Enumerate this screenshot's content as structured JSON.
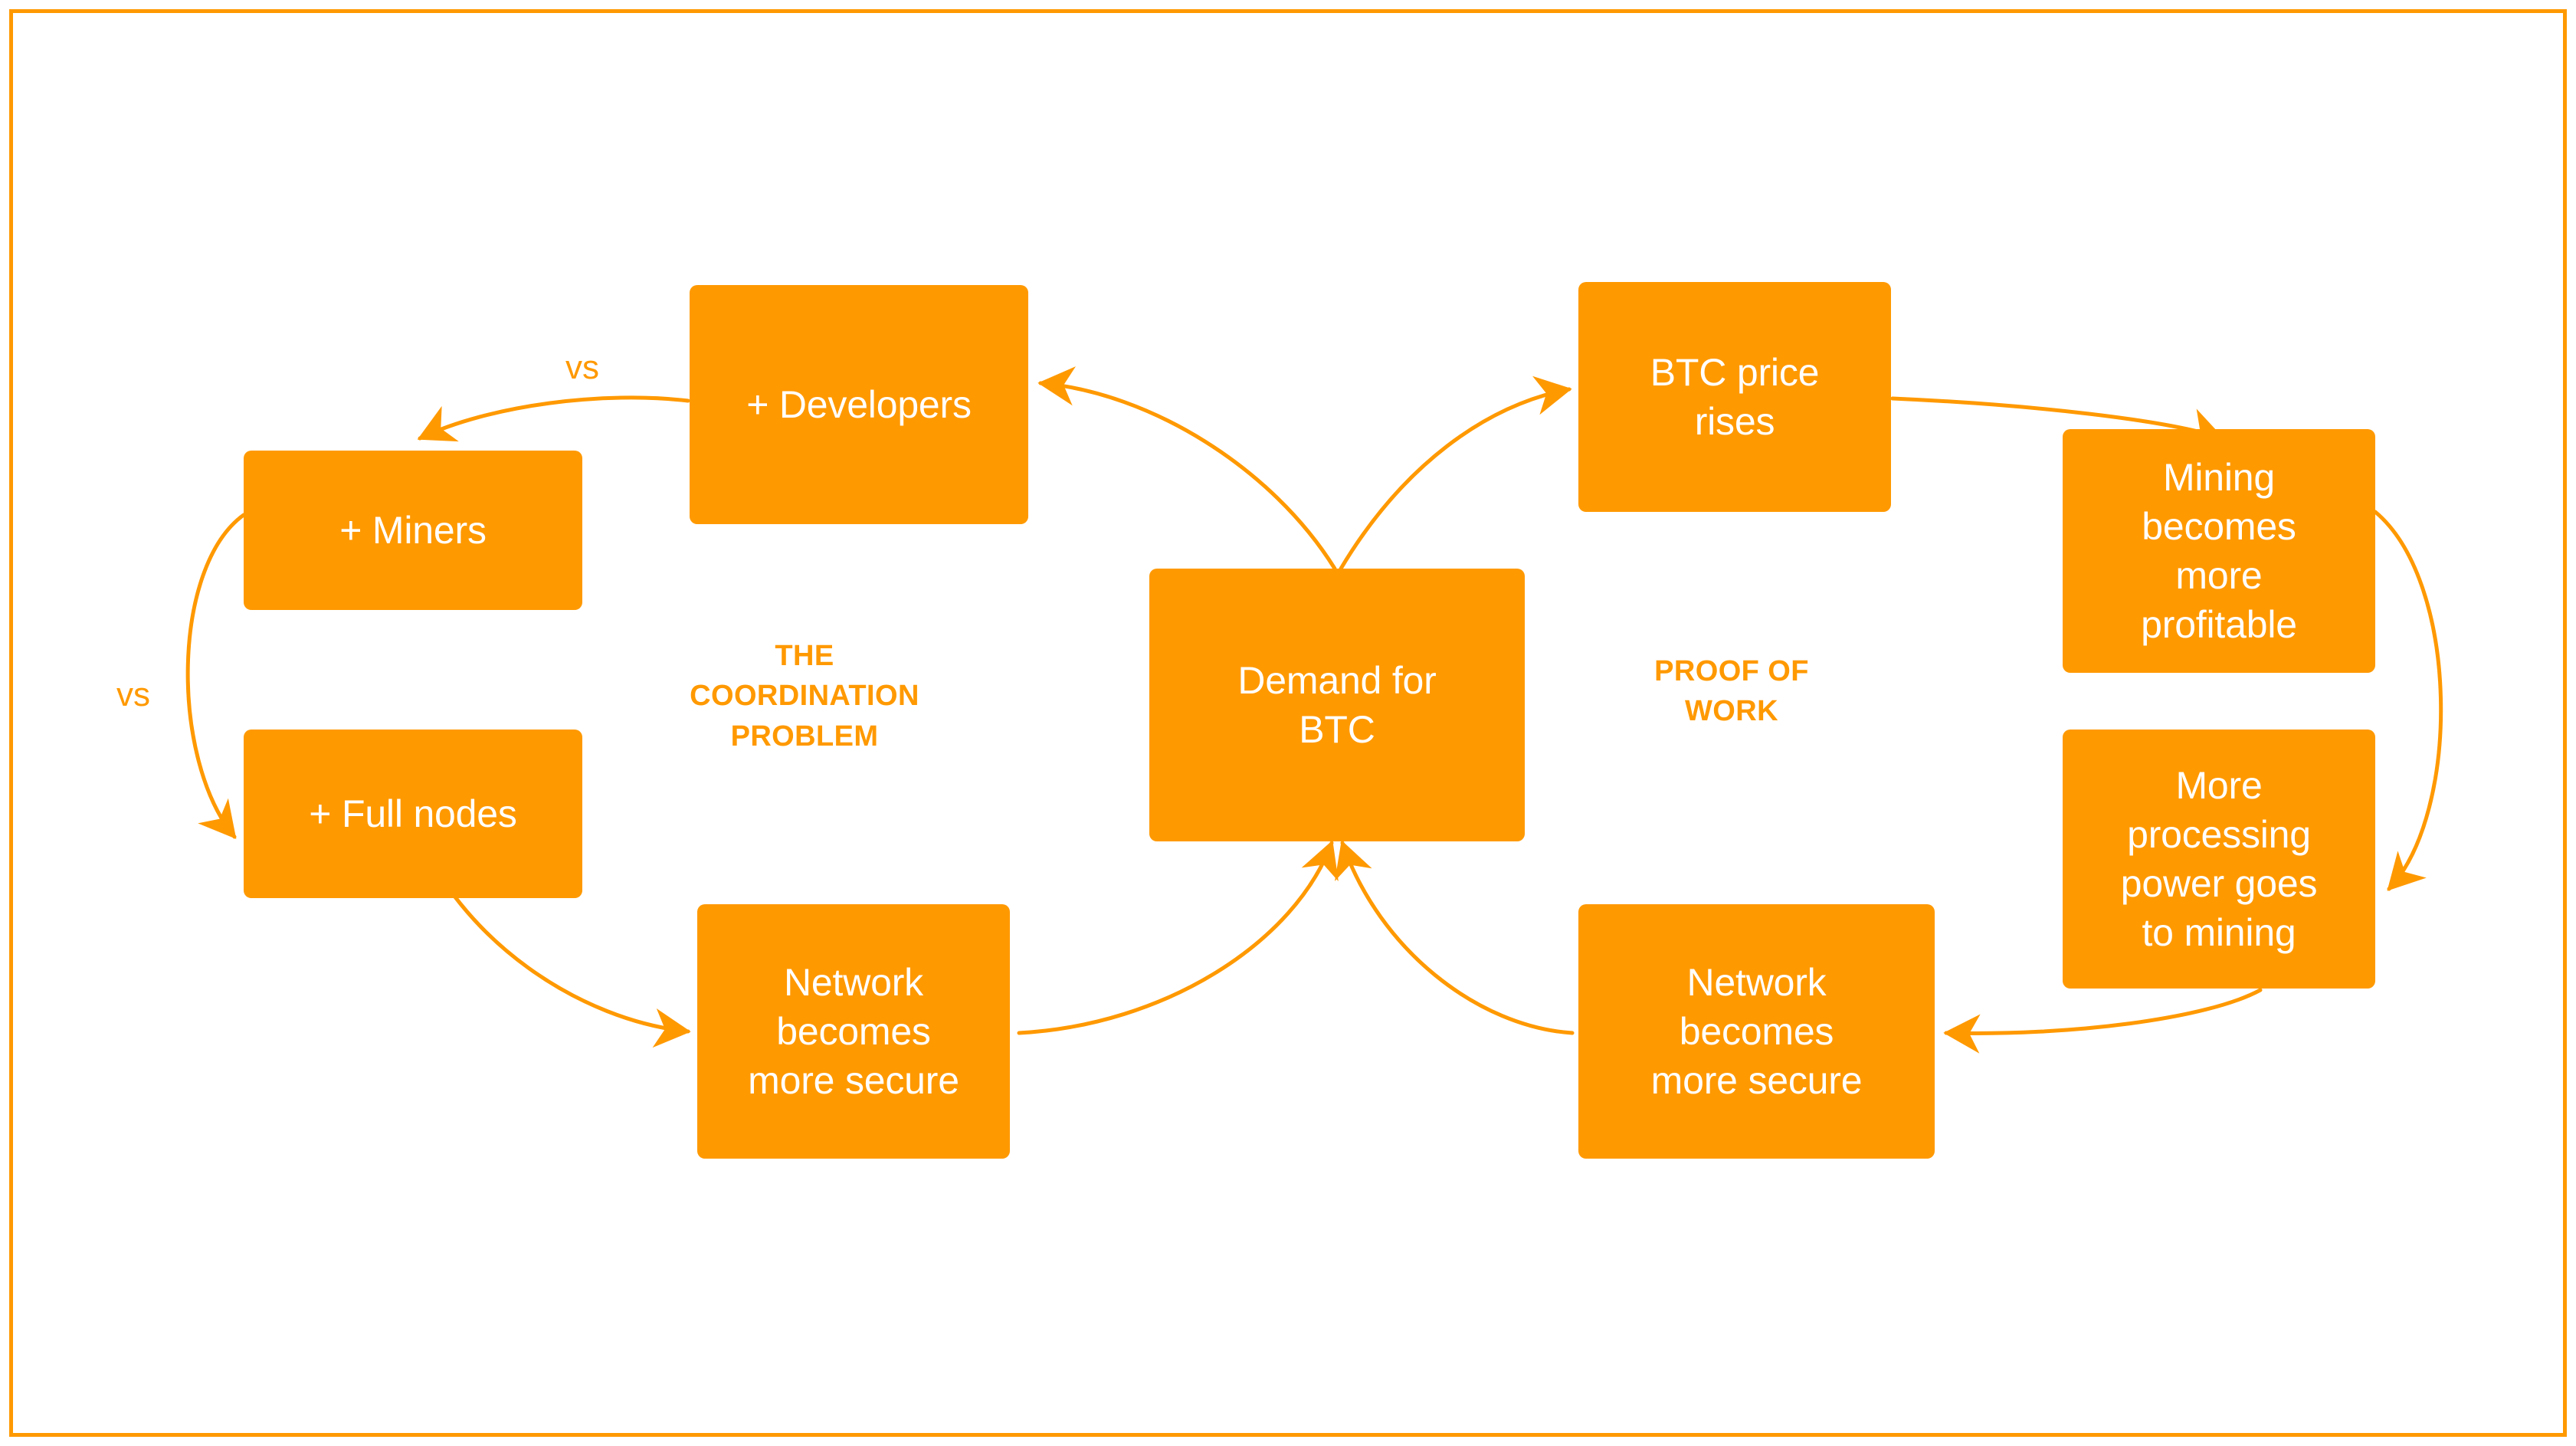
{
  "diagram": {
    "title_hidden": "",
    "accent_color": "#FF9900",
    "background_color": "#FFFFFF",
    "border_color": "#F90",
    "node_text_color": "#FFFFFF",
    "sections": [
      {
        "id": "coordination",
        "label": "THE\nCOORDINATION\nPROBLEM"
      },
      {
        "id": "proof-of-work",
        "label": "PROOF OF\nWORK"
      }
    ],
    "nodes": [
      {
        "id": "miners",
        "label": "+ Miners"
      },
      {
        "id": "full-nodes",
        "label": "+ Full nodes"
      },
      {
        "id": "developers",
        "label": "+ Developers"
      },
      {
        "id": "network-secure-left",
        "label": "Network\nbecomes\nmore secure"
      },
      {
        "id": "demand-for-btc",
        "label": "Demand for\nBTC"
      },
      {
        "id": "btc-price-rises",
        "label": "BTC price\nrises"
      },
      {
        "id": "mining-profitable",
        "label": "Mining\nbecomes\nmore\nprofitable"
      },
      {
        "id": "processing-power",
        "label": "More\nprocessing\npower goes\nto mining"
      },
      {
        "id": "network-secure-right",
        "label": "Network\nbecomes\nmore secure"
      }
    ],
    "edge_labels": [
      {
        "id": "vs-developers-miners",
        "label": "vs"
      },
      {
        "id": "vs-miners-fullnodes",
        "label": "vs"
      }
    ],
    "edges": [
      {
        "from": "demand-for-btc",
        "to": "developers"
      },
      {
        "from": "developers",
        "to": "miners"
      },
      {
        "from": "miners",
        "to": "full-nodes"
      },
      {
        "from": "full-nodes",
        "to": "network-secure-left"
      },
      {
        "from": "network-secure-left",
        "to": "demand-for-btc"
      },
      {
        "from": "demand-for-btc",
        "to": "btc-price-rises"
      },
      {
        "from": "btc-price-rises",
        "to": "mining-profitable"
      },
      {
        "from": "mining-profitable",
        "to": "processing-power"
      },
      {
        "from": "processing-power",
        "to": "network-secure-right"
      },
      {
        "from": "network-secure-right",
        "to": "demand-for-btc"
      }
    ]
  }
}
